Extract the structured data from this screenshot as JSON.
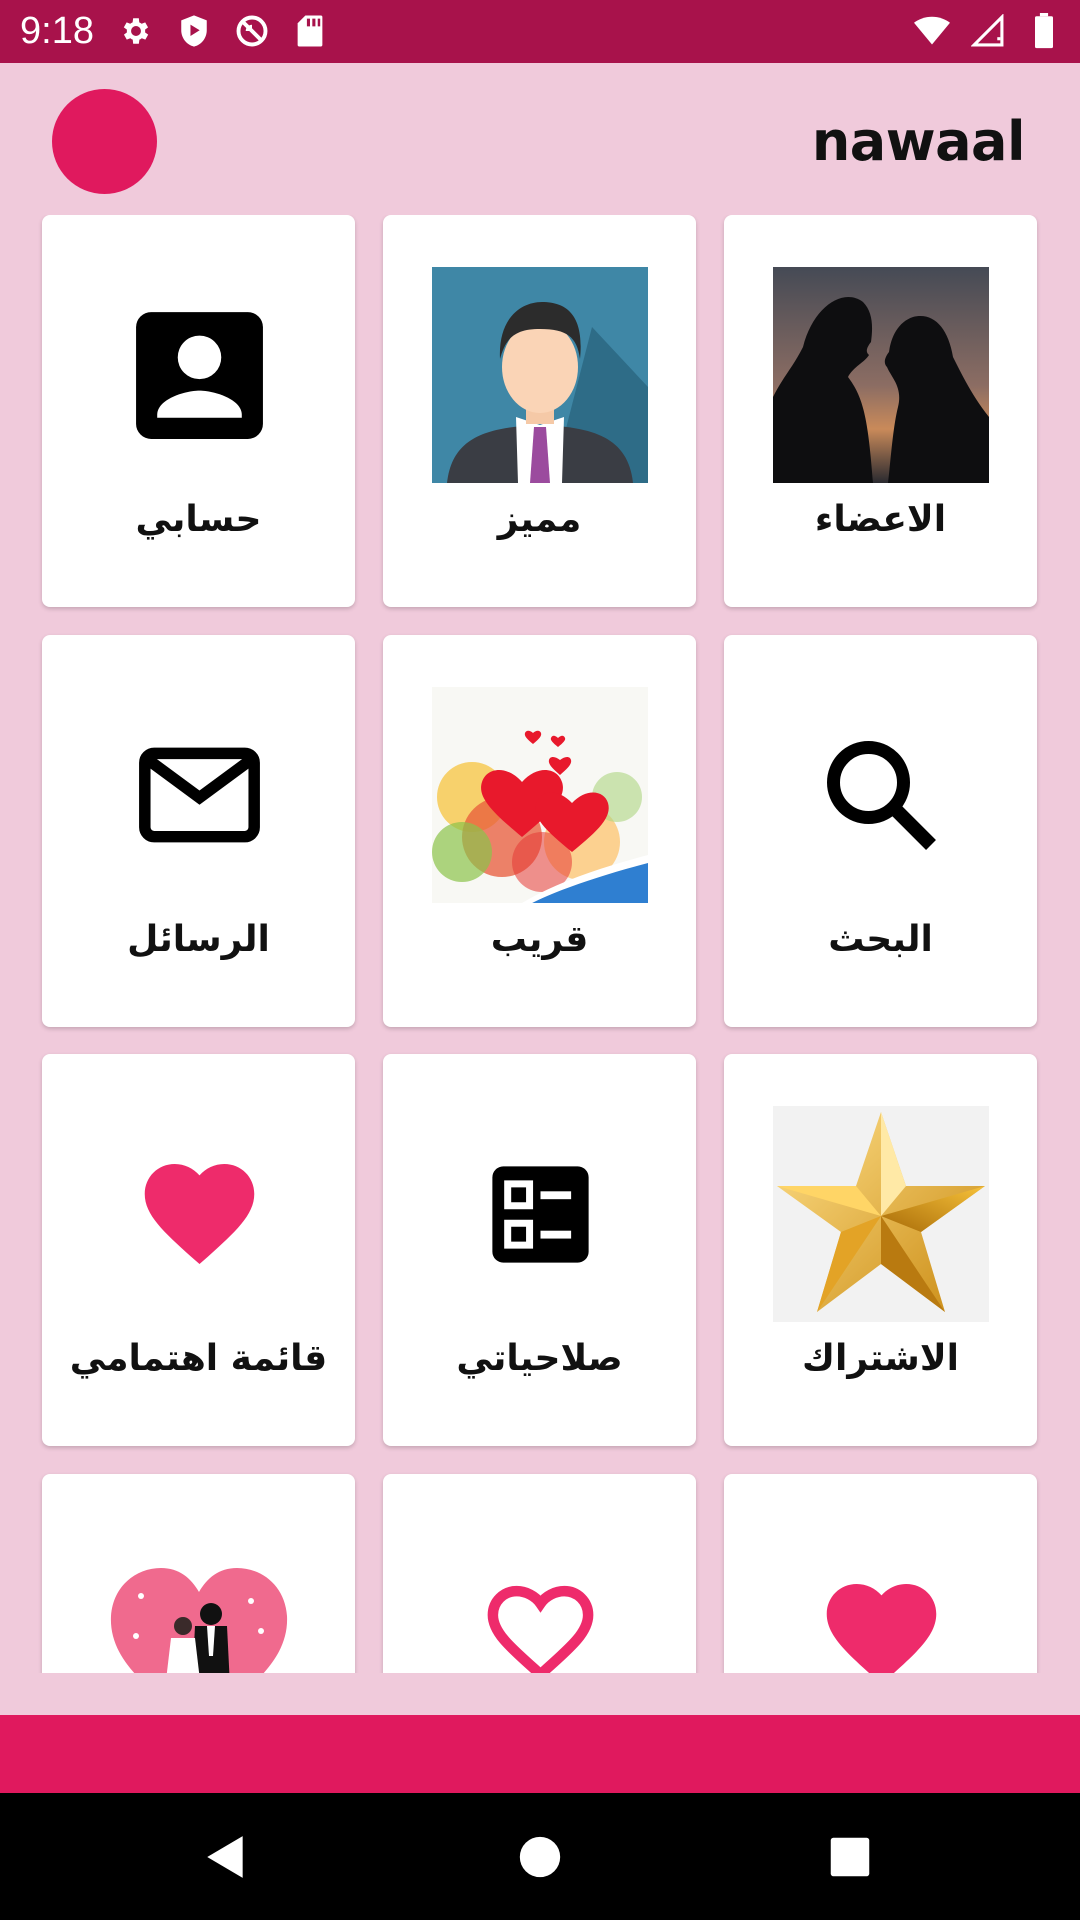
{
  "status_bar": {
    "time": "9:18",
    "left_icons": [
      "settings-icon",
      "shield-play-icon",
      "sync-blocked-icon",
      "sd-card-icon"
    ],
    "right_icons": [
      "wifi-icon",
      "cellular-signal-icon",
      "battery-icon"
    ],
    "background": "#A8124B"
  },
  "header": {
    "title": "nawaal",
    "avatar_color": "#E0195E"
  },
  "tiles": [
    {
      "label": "حسابي",
      "icon": "account-box-icon"
    },
    {
      "label": "مميز",
      "icon": "businessman-avatar-image"
    },
    {
      "label": "الاعضاء",
      "icon": "couple-silhouette-image"
    },
    {
      "label": "الرسائل",
      "icon": "mail-icon"
    },
    {
      "label": "قريب",
      "icon": "hearts-splash-image"
    },
    {
      "label": "البحث",
      "icon": "search-icon"
    },
    {
      "label": "قائمة اهتمامي",
      "icon": "heart-icon"
    },
    {
      "label": "صلاحياتي",
      "icon": "checklist-icon"
    },
    {
      "label": "الاشتراك",
      "icon": "gold-star-image"
    },
    {
      "label": "",
      "icon": "wedding-couple-heart-image"
    },
    {
      "label": "",
      "icon": "heart-outline-icon"
    },
    {
      "label": "",
      "icon": "heart-icon"
    }
  ],
  "colors": {
    "page_background": "#F0CADB",
    "accent": "#E0195E",
    "card_background": "#FFFFFF"
  },
  "nav_bar": {
    "buttons": [
      "back-icon",
      "home-icon",
      "recents-icon"
    ]
  }
}
